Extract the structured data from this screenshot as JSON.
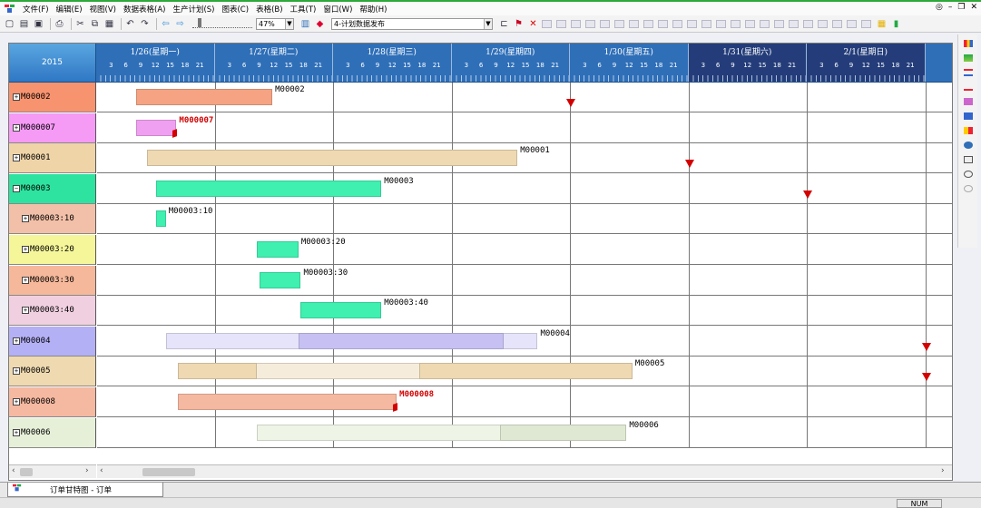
{
  "menubar": {
    "items": [
      "文件(F)",
      "编辑(E)",
      "视图(V)",
      "数据表格(A)",
      "生产计划(S)",
      "图表(C)",
      "表格(B)",
      "工具(T)",
      "窗口(W)",
      "帮助(H)"
    ]
  },
  "toolbar": {
    "zoom_value": "47%",
    "plan_select_value": "4-计划数据发布",
    "left_icons": [
      "new-file-icon",
      "open-file-icon",
      "save-icon",
      "print-icon",
      "cut-icon",
      "copy-icon",
      "paste-icon",
      "undo-icon",
      "redo-icon",
      "back-arrow-icon",
      "forward-arrow-icon"
    ],
    "colors": {
      "brand_green": "#2fa83a",
      "header_blue": "#2f6fb8",
      "weekend_blue": "#243d7a",
      "marker_red": "#d40000"
    }
  },
  "gantt": {
    "year_label": "2015",
    "days": [
      {
        "label": "1/26(星期一)",
        "weekend": false
      },
      {
        "label": "1/27(星期二)",
        "weekend": false
      },
      {
        "label": "1/28(星期三)",
        "weekend": false
      },
      {
        "label": "1/29(星期四)",
        "weekend": false
      },
      {
        "label": "1/30(星期五)",
        "weekend": false
      },
      {
        "label": "1/31(星期六)",
        "weekend": true
      },
      {
        "label": "2/1(星期日)",
        "weekend": true
      }
    ],
    "hour_ticks": [
      "3",
      "6",
      "9",
      "12",
      "15",
      "18",
      "21"
    ],
    "rows": [
      {
        "id": "M00002",
        "label": "M00002",
        "expander": "+",
        "child": false,
        "bg": "#f7936f",
        "bars": [
          {
            "start": 0.33,
            "end": 1.48,
            "color": "#f5a383"
          }
        ],
        "bar_label": "M00002",
        "label_late": false,
        "due_day": 4.0,
        "late_flag": false
      },
      {
        "id": "M000007",
        "label": "M000007",
        "expander": "+",
        "child": false,
        "bg": "#f59af5",
        "bars": [
          {
            "start": 0.33,
            "end": 0.67,
            "color": "#f0a0f0"
          }
        ],
        "bar_label": "M000007",
        "label_late": true,
        "due_day": null,
        "late_flag": true
      },
      {
        "id": "M00001",
        "label": "M00001",
        "expander": "+",
        "child": false,
        "bg": "#efd4a8",
        "bars": [
          {
            "start": 0.42,
            "end": 3.55,
            "color": "#eed9b2"
          }
        ],
        "bar_label": "M00001",
        "label_late": false,
        "due_day": 5.0,
        "late_flag": false
      },
      {
        "id": "M00003",
        "label": "M00003",
        "expander": "−",
        "child": false,
        "bg": "#2ee3a0",
        "bars": [
          {
            "start": 0.5,
            "end": 2.4,
            "color": "#3ff0b0"
          }
        ],
        "bar_label": "M00003",
        "label_late": false,
        "due_day": 6.0,
        "late_flag": false
      },
      {
        "id": "M00003:10",
        "label": "M00003:10",
        "expander": "+",
        "child": true,
        "bg": "#f2c0a8",
        "bars": [
          {
            "start": 0.5,
            "end": 0.58,
            "color": "#3ff0b0"
          }
        ],
        "bar_label": "M00003:10",
        "label_late": false,
        "due_day": null,
        "late_flag": false
      },
      {
        "id": "M00003:20",
        "label": "M00003:20",
        "expander": "+",
        "child": true,
        "bg": "#f5f59a",
        "bars": [
          {
            "start": 1.35,
            "end": 1.7,
            "color": "#3ff0b0"
          }
        ],
        "bar_label": "M00003:20",
        "label_late": false,
        "due_day": null,
        "late_flag": false
      },
      {
        "id": "M00003:30",
        "label": "M00003:30",
        "expander": "+",
        "child": true,
        "bg": "#f6b89a",
        "bars": [
          {
            "start": 1.37,
            "end": 1.72,
            "color": "#3ff0b0"
          }
        ],
        "bar_label": "M00003:30",
        "label_late": false,
        "due_day": null,
        "late_flag": false
      },
      {
        "id": "M00003:40",
        "label": "M00003:40",
        "expander": "+",
        "child": true,
        "bg": "#f0d0e0",
        "bars": [
          {
            "start": 1.72,
            "end": 2.4,
            "color": "#3ff0b0"
          }
        ],
        "bar_label": "M00003:40",
        "label_late": false,
        "due_day": null,
        "late_flag": false
      },
      {
        "id": "M00004",
        "label": "M00004",
        "expander": "+",
        "child": false,
        "bg": "#b4b0f5",
        "bars": [
          {
            "start": 0.58,
            "end": 3.72,
            "color": "#e6e4fb"
          },
          {
            "start": 1.7,
            "end": 3.43,
            "color": "#c6c1f2"
          }
        ],
        "bar_label": "M00004",
        "label_late": false,
        "due_day": 7.0,
        "late_flag": false
      },
      {
        "id": "M00005",
        "label": "M00005",
        "expander": "+",
        "child": false,
        "bg": "#efd9b0",
        "bars": [
          {
            "start": 0.68,
            "end": 4.52,
            "color": "#f6ecdb"
          },
          {
            "start": 0.68,
            "end": 1.35,
            "color": "#eed9b2"
          },
          {
            "start": 2.72,
            "end": 4.52,
            "color": "#eed9b2"
          }
        ],
        "bar_label": "M00005",
        "label_late": false,
        "due_day": 7.0,
        "late_flag": false
      },
      {
        "id": "M000008",
        "label": "M000008",
        "expander": "+",
        "child": false,
        "bg": "#f5b8a0",
        "bars": [
          {
            "start": 0.68,
            "end": 2.53,
            "color": "#f5b8a0"
          }
        ],
        "bar_label": "M000008",
        "label_late": true,
        "due_day": null,
        "late_flag": true
      },
      {
        "id": "M00006",
        "label": "M00006",
        "expander": "+",
        "child": false,
        "bg": "#e6f0d8",
        "bars": [
          {
            "start": 1.35,
            "end": 4.47,
            "color": "#eef4e6"
          },
          {
            "start": 3.4,
            "end": 4.47,
            "color": "#dfe8d2"
          }
        ],
        "bar_label": "M00006",
        "label_late": false,
        "due_day": null,
        "late_flag": false
      }
    ]
  },
  "tab": {
    "label": "订单甘特图 - 订单"
  },
  "status": {
    "num": "NUM"
  }
}
